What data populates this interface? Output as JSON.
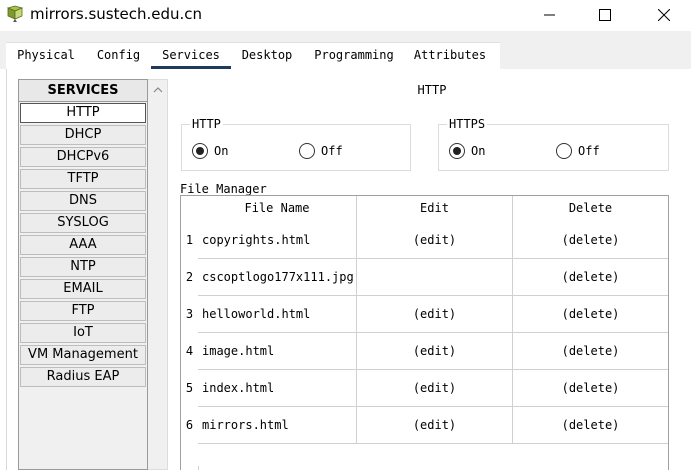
{
  "window": {
    "title": "mirrors.sustech.edu.cn",
    "app_icon": "packet-tracer-device-icon",
    "controls": [
      "minimize-icon",
      "maximize-icon",
      "close-icon"
    ]
  },
  "tabs": [
    {
      "label": "Physical"
    },
    {
      "label": "Config"
    },
    {
      "label": "Services",
      "active": true
    },
    {
      "label": "Desktop"
    },
    {
      "label": "Programming"
    },
    {
      "label": "Attributes"
    }
  ],
  "services": {
    "header": "SERVICES",
    "items": [
      "HTTP",
      "DHCP",
      "DHCPv6",
      "TFTP",
      "DNS",
      "SYSLOG",
      "AAA",
      "NTP",
      "EMAIL",
      "FTP",
      "IoT",
      "VM Management",
      "Radius EAP"
    ],
    "selected": "HTTP"
  },
  "panel": {
    "title": "HTTP",
    "http": {
      "label": "HTTP",
      "on_label": "On",
      "off_label": "Off",
      "value": "On"
    },
    "https": {
      "label": "HTTPS",
      "on_label": "On",
      "off_label": "Off",
      "value": "On"
    },
    "file_manager": {
      "label": "File Manager",
      "columns": [
        "File Name",
        "Edit",
        "Delete"
      ],
      "rows": [
        {
          "num": "1",
          "name": "copyrights.html",
          "edit": "(edit)",
          "delete": "(delete)"
        },
        {
          "num": "2",
          "name": "cscoptlogo177x111.jpg",
          "edit": "",
          "delete": "(delete)"
        },
        {
          "num": "3",
          "name": "helloworld.html",
          "edit": "(edit)",
          "delete": "(delete)"
        },
        {
          "num": "4",
          "name": "image.html",
          "edit": "(edit)",
          "delete": "(delete)"
        },
        {
          "num": "5",
          "name": "index.html",
          "edit": "(edit)",
          "delete": "(delete)"
        },
        {
          "num": "6",
          "name": "mirrors.html",
          "edit": "(edit)",
          "delete": "(delete)"
        }
      ]
    }
  },
  "colors": {
    "active_tab_underline": "#1f3a5f",
    "sidebar_bg": "#f0f0f0"
  }
}
